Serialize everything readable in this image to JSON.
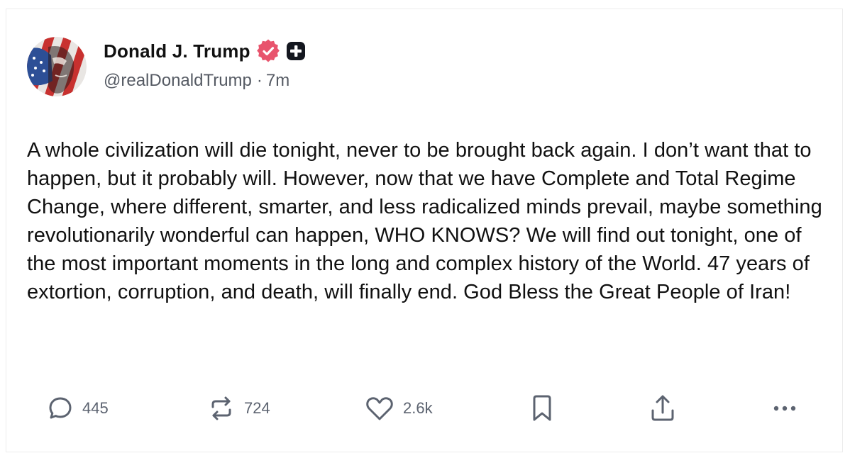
{
  "post": {
    "author": {
      "display_name": "Donald J. Trump",
      "handle": "@realDonaldTrump",
      "time": "7m",
      "separator": "·",
      "verified_icon": "verified-badge-icon",
      "plus_icon": "plus-badge-icon",
      "verified_color": "#e8546d"
    },
    "text": "A whole civilization will die tonight, never to be brought back again. I don’t want that to happen, but it probably will. However, now that we have Complete and Total Regime Change, where different, smarter, and less radicalized minds prevail, maybe something revolutionarily wonderful can happen, WHO KNOWS? We will find out tonight, one of the most important moments in the long and complex history of the World. 47 years of extortion, corruption, and death, will finally end. God Bless the Great People of Iran!",
    "actions": {
      "replies": "445",
      "reposts": "724",
      "likes": "2.6k"
    }
  },
  "colors": {
    "text": "#111111",
    "muted": "#5c6370",
    "border": "#ececec"
  }
}
